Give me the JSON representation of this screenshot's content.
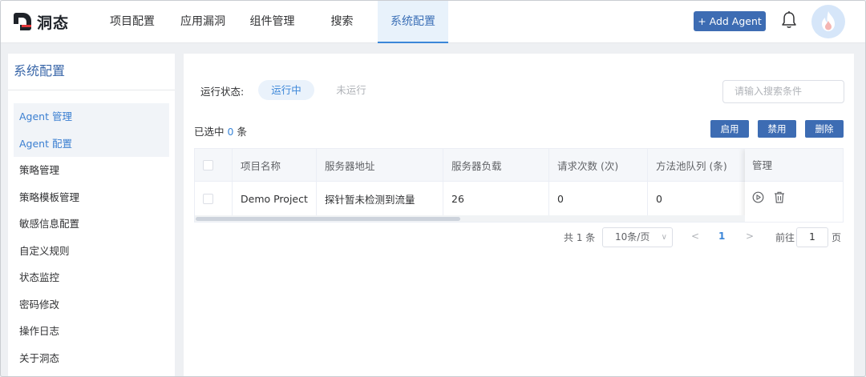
{
  "app": {
    "name": "洞态"
  },
  "nav": {
    "items": [
      {
        "label": "项目配置",
        "active": false
      },
      {
        "label": "应用漏洞",
        "active": false
      },
      {
        "label": "组件管理",
        "active": false
      },
      {
        "label": "搜索",
        "active": false
      },
      {
        "label": "系统配置",
        "active": true
      }
    ]
  },
  "header": {
    "add_agent_label": "+ Add Agent",
    "icons": [
      "bell-icon",
      "avatar-flame-icon"
    ]
  },
  "sidebar": {
    "title": "系统配置",
    "items": [
      {
        "label": "Agent 管理",
        "selected": true
      },
      {
        "label": "Agent 配置",
        "selected": true
      },
      {
        "label": "策略管理",
        "selected": false
      },
      {
        "label": "策略模板管理",
        "selected": false
      },
      {
        "label": "敏感信息配置",
        "selected": false
      },
      {
        "label": "自定义规则",
        "selected": false
      },
      {
        "label": "状态监控",
        "selected": false
      },
      {
        "label": "密码修改",
        "selected": false
      },
      {
        "label": "操作日志",
        "selected": false
      },
      {
        "label": "关于洞态",
        "selected": false
      }
    ]
  },
  "filter": {
    "label": "运行状态:",
    "options": [
      {
        "label": "运行中",
        "active": true
      },
      {
        "label": "未运行",
        "active": false
      }
    ],
    "search_placeholder": "请输入搜索条件"
  },
  "selection": {
    "prefix": "已选中",
    "count": "0",
    "suffix": "条"
  },
  "actions": {
    "enable": "启用",
    "disable": "禁用",
    "delete": "删除"
  },
  "table": {
    "headers": [
      "项目名称",
      "服务器地址",
      "服务器负载",
      "请求次数 (次)",
      "方法池队列 (条)",
      "管理"
    ],
    "rows": [
      {
        "project": "Demo Project",
        "server": "探针暂未检测到流量",
        "load": "26",
        "requests": "0",
        "queue": "0"
      }
    ],
    "row_icons": [
      "play-circle-icon",
      "trash-icon"
    ]
  },
  "pagination": {
    "total": "共 1 条",
    "page_size": "10条/页",
    "prev": "<",
    "current": "1",
    "next": ">",
    "goto_label": "前往",
    "goto_value": "1",
    "goto_unit": "页"
  },
  "colors": {
    "primary": "#3d6cb3",
    "accent": "#3b86d8",
    "logo_red": "#e2373a"
  }
}
